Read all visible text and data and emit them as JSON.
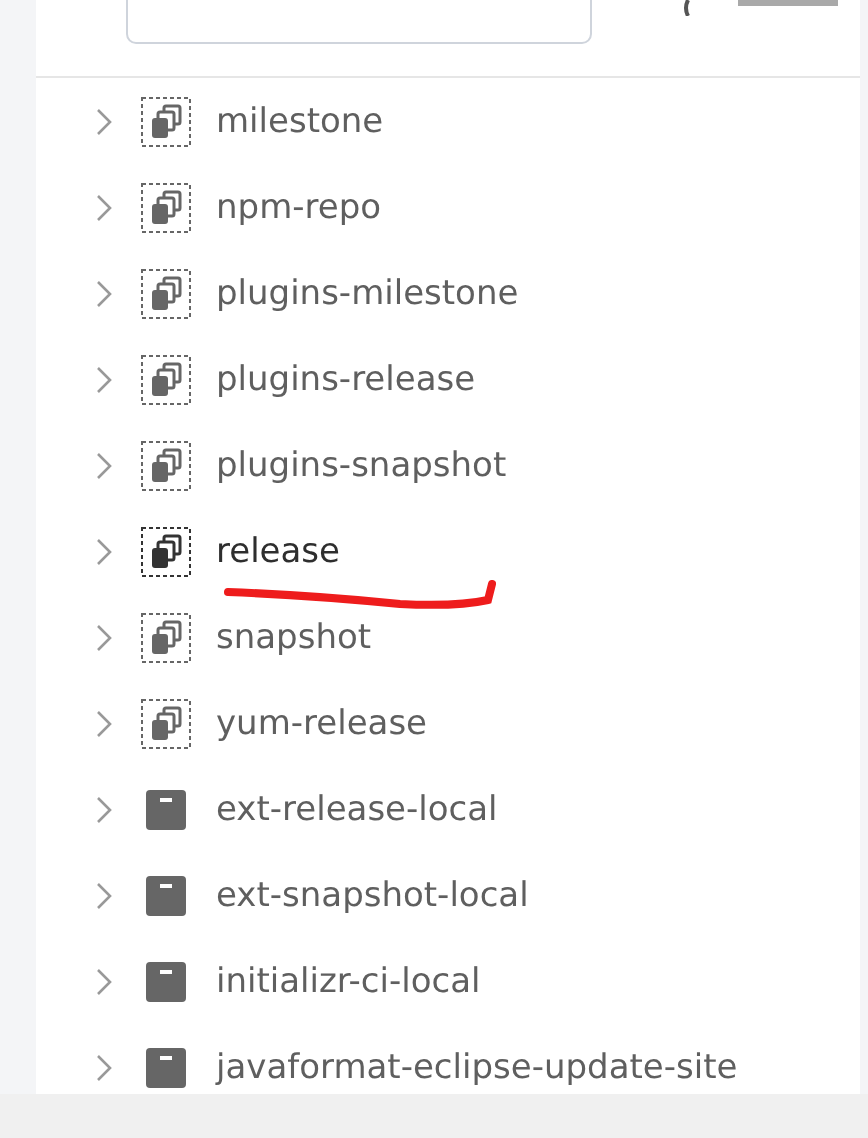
{
  "repositories": [
    {
      "name": "milestone",
      "kind": "virtual",
      "selected": false
    },
    {
      "name": "npm-repo",
      "kind": "virtual",
      "selected": false
    },
    {
      "name": "plugins-milestone",
      "kind": "virtual",
      "selected": false
    },
    {
      "name": "plugins-release",
      "kind": "virtual",
      "selected": false
    },
    {
      "name": "plugins-snapshot",
      "kind": "virtual",
      "selected": false
    },
    {
      "name": "release",
      "kind": "virtual",
      "selected": true
    },
    {
      "name": "snapshot",
      "kind": "virtual",
      "selected": false
    },
    {
      "name": "yum-release",
      "kind": "virtual",
      "selected": false
    },
    {
      "name": "ext-release-local",
      "kind": "local",
      "selected": false
    },
    {
      "name": "ext-snapshot-local",
      "kind": "local",
      "selected": false
    },
    {
      "name": "initializr-ci-local",
      "kind": "local",
      "selected": false
    },
    {
      "name": "javaformat-eclipse-update-site",
      "kind": "local",
      "selected": false
    }
  ]
}
